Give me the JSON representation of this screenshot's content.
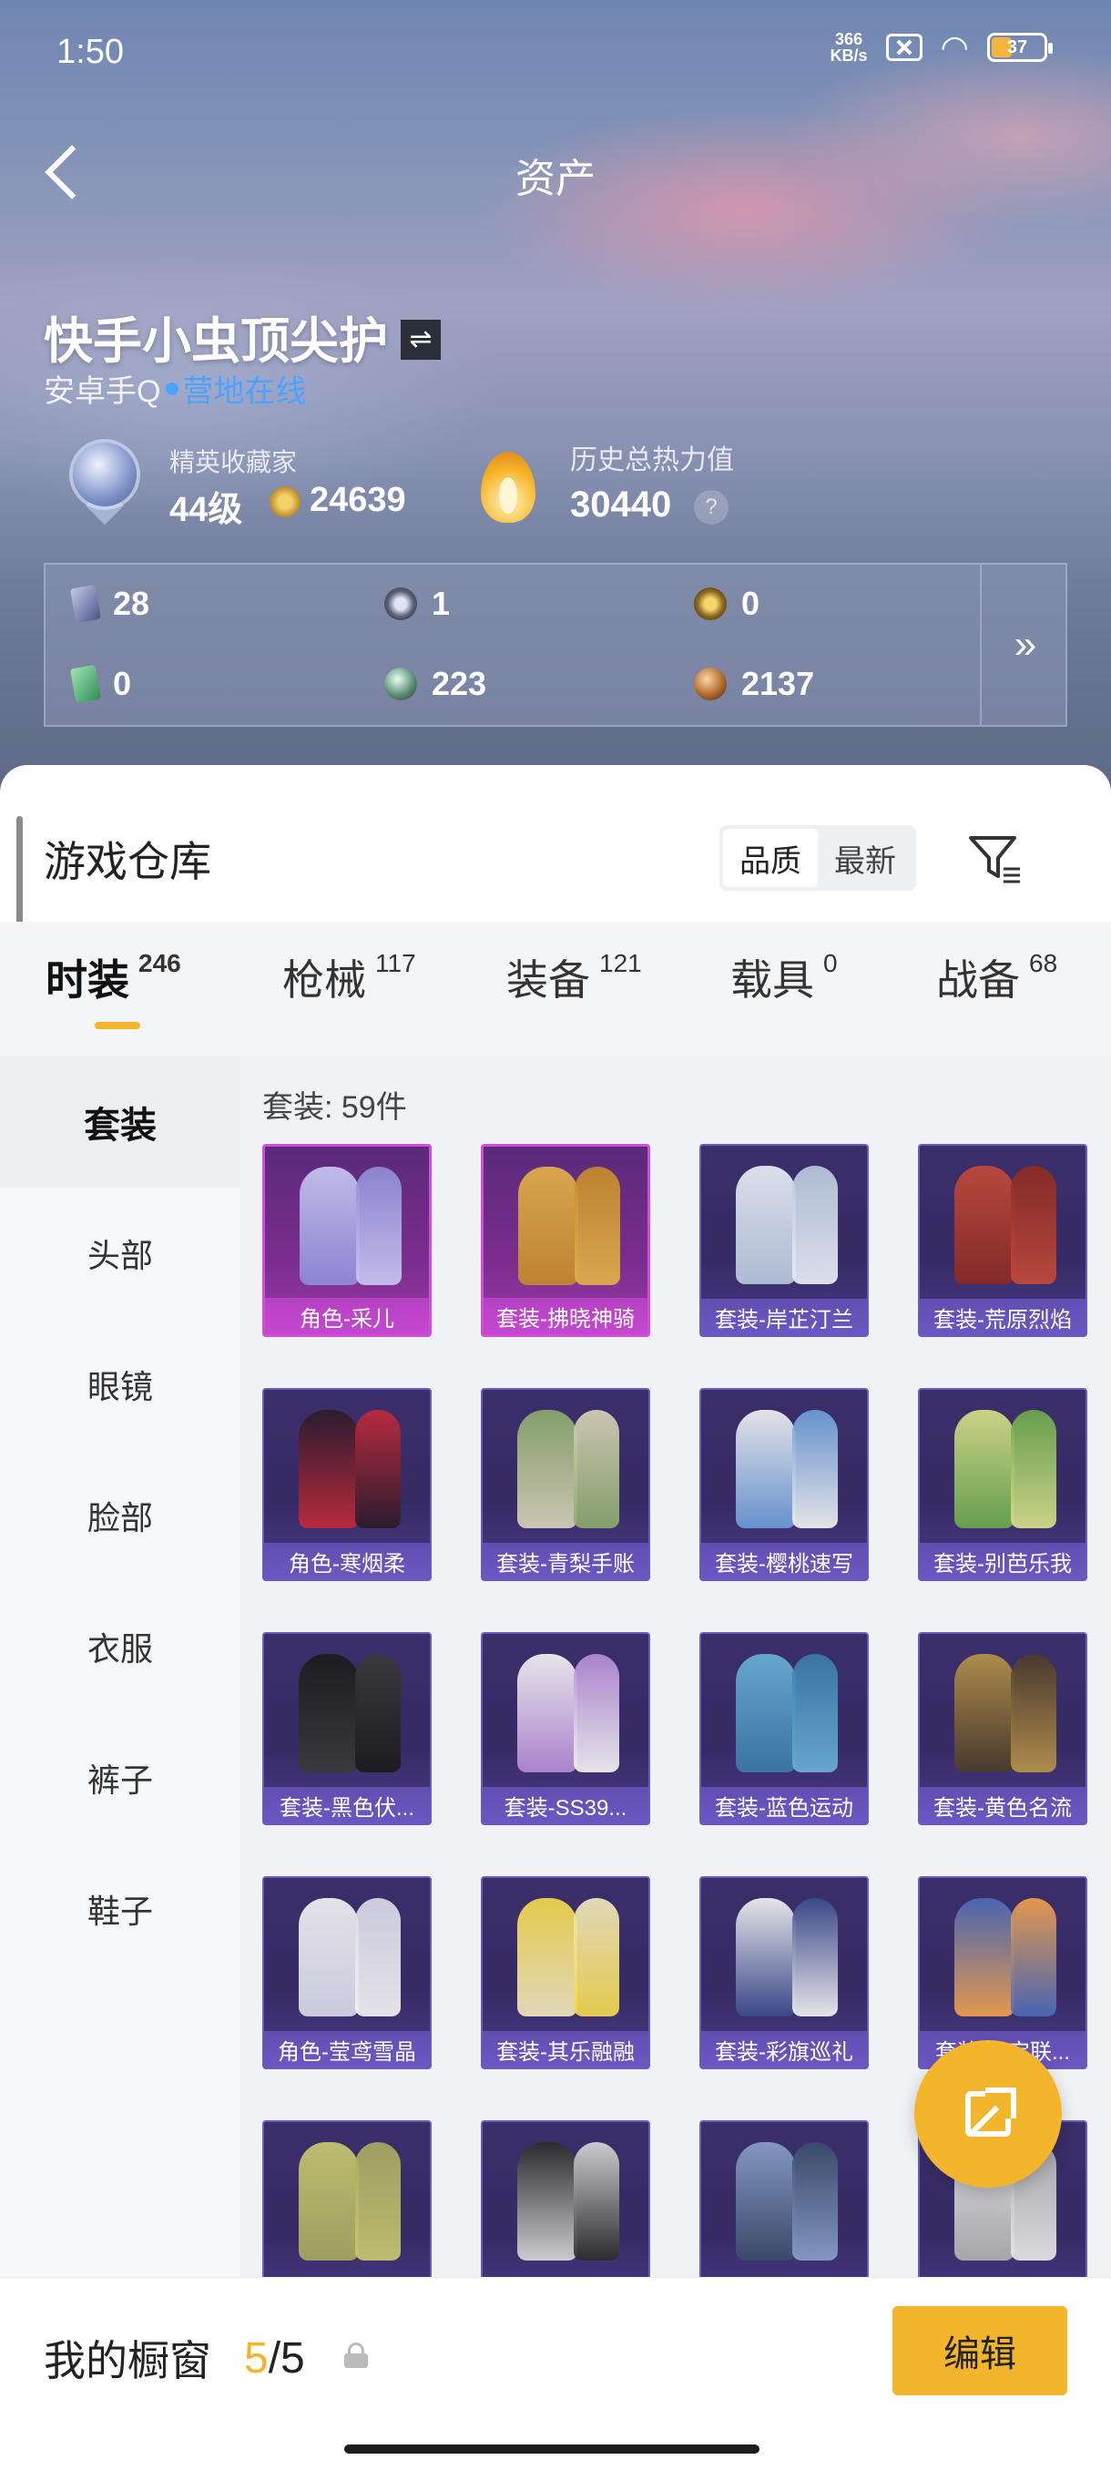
{
  "status_bar": {
    "time": "1:50",
    "speed_top": "366",
    "speed_unit": "KB/s",
    "battery": "37"
  },
  "header": {
    "title": "资产"
  },
  "profile": {
    "username": "快手小虫顶尖护",
    "platform": "安卓手Q",
    "online_status": "营地在线",
    "rank_title": "精英收藏家",
    "rank_level": "44级",
    "collection_points": "24639",
    "heat_title": "历史总热力值",
    "heat_value": "30440",
    "help": "?"
  },
  "currencies": [
    {
      "icon": "purple-card-icon",
      "value": "28"
    },
    {
      "icon": "silver-coin-icon",
      "value": "1"
    },
    {
      "icon": "gold-coin-icon",
      "value": "0"
    },
    {
      "icon": "green-card-icon",
      "value": "0"
    },
    {
      "icon": "pearl-icon",
      "value": "223"
    },
    {
      "icon": "bronze-coin-icon",
      "value": "2137"
    }
  ],
  "currency_more": "»",
  "warehouse": {
    "title": "游戏仓库",
    "sort_options": [
      "品质",
      "最新"
    ],
    "sort_active": "品质"
  },
  "tabs": [
    {
      "label": "时装",
      "count": "246"
    },
    {
      "label": "枪械",
      "count": "117"
    },
    {
      "label": "装备",
      "count": "121"
    },
    {
      "label": "载具",
      "count": "0"
    },
    {
      "label": "战备",
      "count": "68"
    }
  ],
  "side_nav": [
    "套装",
    "头部",
    "眼镜",
    "脸部",
    "衣服",
    "裤子",
    "鞋子"
  ],
  "grid": {
    "heading": "套装: 59件",
    "items": [
      {
        "label": "角色-采儿",
        "tier": "legend"
      },
      {
        "label": "套装-拂晓神骑",
        "tier": "legend"
      },
      {
        "label": "套装-岸芷汀兰",
        "tier": "epic"
      },
      {
        "label": "套装-荒原烈焰",
        "tier": "epic"
      },
      {
        "label": "角色-寒烟柔",
        "tier": "epic"
      },
      {
        "label": "套装-青梨手账",
        "tier": "epic"
      },
      {
        "label": "套装-樱桃速写",
        "tier": "epic"
      },
      {
        "label": "套装-别芭乐我",
        "tier": "epic"
      },
      {
        "label": "套装-黑色伏...",
        "tier": "epic"
      },
      {
        "label": "套装-SS39...",
        "tier": "epic"
      },
      {
        "label": "套装-蓝色运动",
        "tier": "epic"
      },
      {
        "label": "套装-黄色名流",
        "tier": "epic"
      },
      {
        "label": "角色-莹鸢雪晶",
        "tier": "epic"
      },
      {
        "label": "套装-其乐融融",
        "tier": "epic"
      },
      {
        "label": "套装-彩旗巡礼",
        "tier": "epic"
      },
      {
        "label": "套装-云宝联...",
        "tier": "epic"
      },
      {
        "label": "",
        "tier": "epic"
      },
      {
        "label": "",
        "tier": "epic"
      },
      {
        "label": "",
        "tier": "epic"
      },
      {
        "label": "",
        "tier": "epic"
      }
    ]
  },
  "showcase": {
    "title": "我的橱窗",
    "current": "5",
    "total": "/5",
    "edit_label": "编辑"
  }
}
